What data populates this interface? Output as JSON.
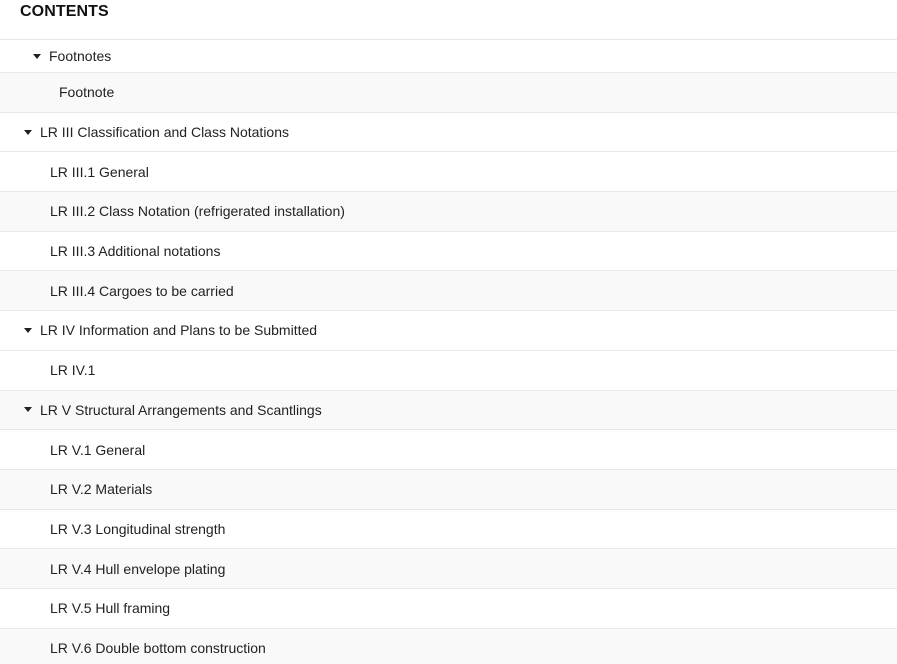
{
  "header": {
    "title": "CONTENTS"
  },
  "toc": [
    {
      "label": "Footnotes",
      "expanded": true,
      "shaded": false
    },
    {
      "label": "Footnote",
      "shaded": true
    },
    {
      "label": "LR III Classification and Class Notations",
      "expanded": true,
      "shaded": false
    },
    {
      "label": "LR III.1 General",
      "shaded": false
    },
    {
      "label": "LR III.2 Class Notation (refrigerated installation)",
      "shaded": true
    },
    {
      "label": "LR III.3 Additional notations",
      "shaded": false
    },
    {
      "label": "LR III.4 Cargoes to be carried",
      "shaded": true
    },
    {
      "label": "LR IV Information and Plans to be Submitted",
      "expanded": true,
      "shaded": false
    },
    {
      "label": "LR IV.1",
      "shaded": false
    },
    {
      "label": "LR V Structural Arrangements and Scantlings",
      "expanded": true,
      "shaded": true
    },
    {
      "label": "LR V.1 General",
      "shaded": false
    },
    {
      "label": "LR V.2 Materials",
      "shaded": true
    },
    {
      "label": "LR V.3 Longitudinal strength",
      "shaded": false
    },
    {
      "label": "LR V.4 Hull envelope plating",
      "shaded": true
    },
    {
      "label": "LR V.5 Hull framing",
      "shaded": false
    },
    {
      "label": "LR V.6 Double bottom construction",
      "shaded": true
    }
  ]
}
